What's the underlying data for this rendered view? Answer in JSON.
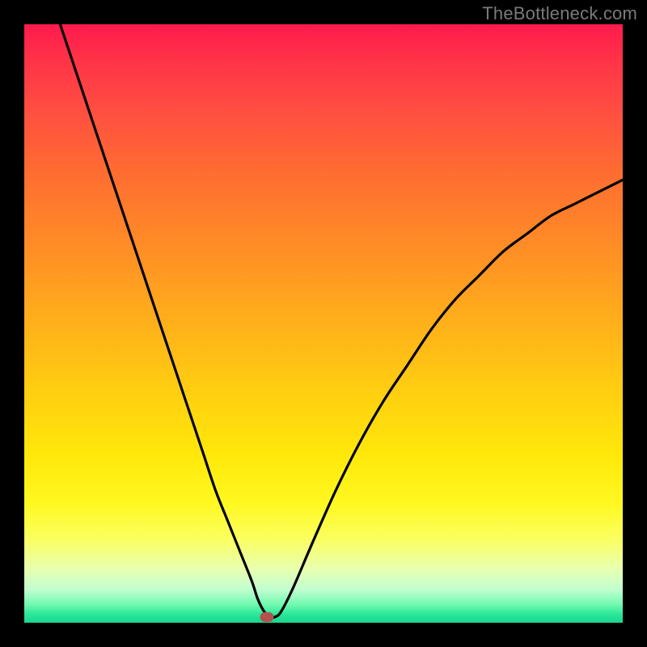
{
  "watermark": "TheBottleneck.com",
  "chart_data": {
    "type": "line",
    "title": "",
    "xlabel": "",
    "ylabel": "",
    "xlim": [
      0,
      100
    ],
    "ylim": [
      0,
      100
    ],
    "grid": false,
    "legend": false,
    "marker": {
      "x": 40.5,
      "y": 1.0,
      "color": "#b3514e"
    },
    "series": [
      {
        "name": "bottleneck-curve",
        "color": "#000000",
        "x": [
          6,
          8,
          10,
          12,
          14,
          16,
          18,
          20,
          22,
          24,
          26,
          28,
          30,
          32,
          34,
          36,
          38,
          39,
          40,
          41,
          42,
          43,
          45,
          48,
          52,
          56,
          60,
          64,
          68,
          72,
          76,
          80,
          84,
          88,
          92,
          96,
          100
        ],
        "y": [
          100,
          94,
          88,
          82,
          76,
          70,
          64,
          58,
          52,
          46,
          40,
          34,
          28,
          22,
          17,
          12,
          7,
          4,
          2,
          1,
          1,
          2,
          6,
          13,
          22,
          30,
          37,
          43,
          49,
          54,
          58,
          62,
          65,
          68,
          70,
          72,
          74
        ]
      }
    ]
  }
}
